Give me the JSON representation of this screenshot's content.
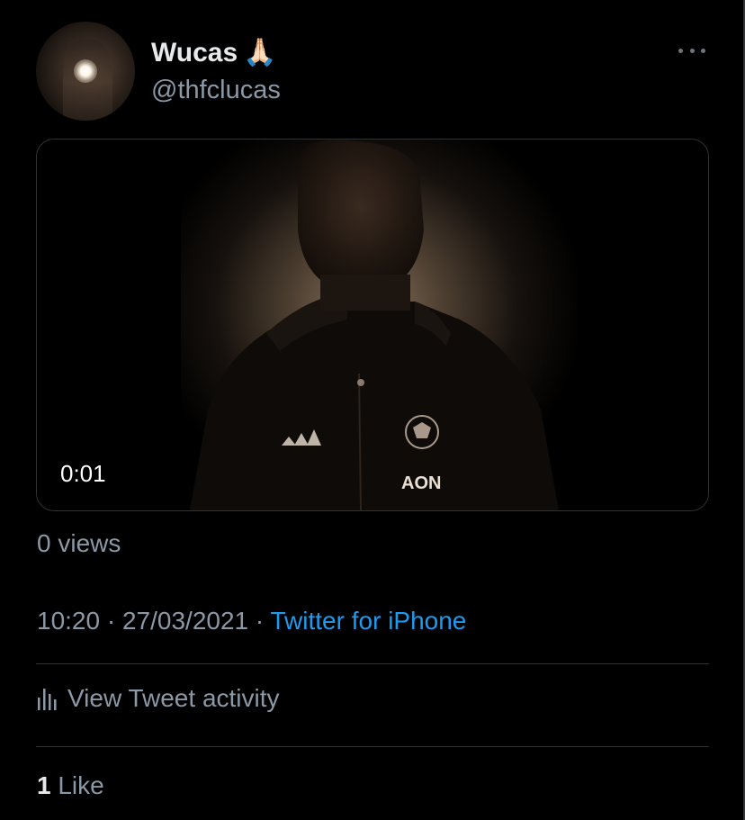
{
  "tweet": {
    "author": {
      "display_name": "Wucas",
      "emoji": "🙏🏻",
      "handle": "@thfclucas",
      "avatar_icon": "profile-photo"
    },
    "media": {
      "type": "video",
      "duration": "0:01"
    },
    "views": "0 views",
    "time": "10:20",
    "separator": "·",
    "date": "27/03/2021",
    "source": "Twitter for iPhone",
    "activity_label": "View Tweet activity",
    "likes_count": "1",
    "likes_label": "Like"
  },
  "colors": {
    "background": "#000000",
    "primary_text": "#e7e9ea",
    "secondary_text": "#8b98a5",
    "link": "#1d9bf0",
    "divider": "#2f3336"
  },
  "icons": {
    "more": "more-horizontal-icon",
    "activity": "bar-chart-icon"
  }
}
